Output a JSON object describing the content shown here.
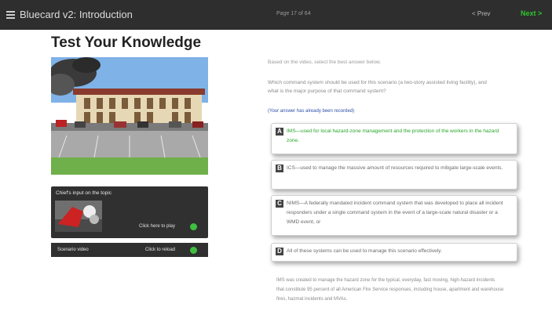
{
  "header": {
    "title": "Bluecard v2: Introduction",
    "page_indicator": "Page 17 of 64",
    "prev_label": "< Prev",
    "next_label": "Next",
    "next_arrow": ">"
  },
  "page_title": "Test Your Knowledge",
  "chief_panel": {
    "title": "Chief's input on the topic",
    "play_label": "Click here to play"
  },
  "scenario_bar": {
    "label": "Scenario video",
    "reload_label": "Click to reload"
  },
  "instructions": "Based on the video, select the best answer below.",
  "question": "Which command system should be used for this scenario (a two-story assisted living facility), and what is the major purpose of that command system?",
  "status_note": "(Your answer has already been recorded)",
  "options": [
    {
      "letter": "A",
      "text": "IMS—used for local hazard-zone management and the protection of the workers in the hazard zone."
    },
    {
      "letter": "B",
      "text": "ICS—used to manage the massive amount of resources required to mitigate large-scale events."
    },
    {
      "letter": "C",
      "text": "NIMS—A federally mandated incident command system that was developed to place all incident responders under a single command system in the event of a large-scale natural disaster or a WMD event, or"
    },
    {
      "letter": "D",
      "text": "All of these systems can be used to manage this scenario effectively."
    }
  ],
  "feedback": "IMS was created to manage the hazard zone for the typical, everyday, fast moving, high-hazard incidents that constitute 95 percent of all American Fire Service responses, including house, apartment and warehouse fires, hazmat incidents and MVAs.",
  "colors": {
    "topbar": "#2e2e2e",
    "next": "#2ec52e",
    "correct_answer": "#27a52a",
    "status_note": "#2d4fa8",
    "panel": "#303030"
  }
}
